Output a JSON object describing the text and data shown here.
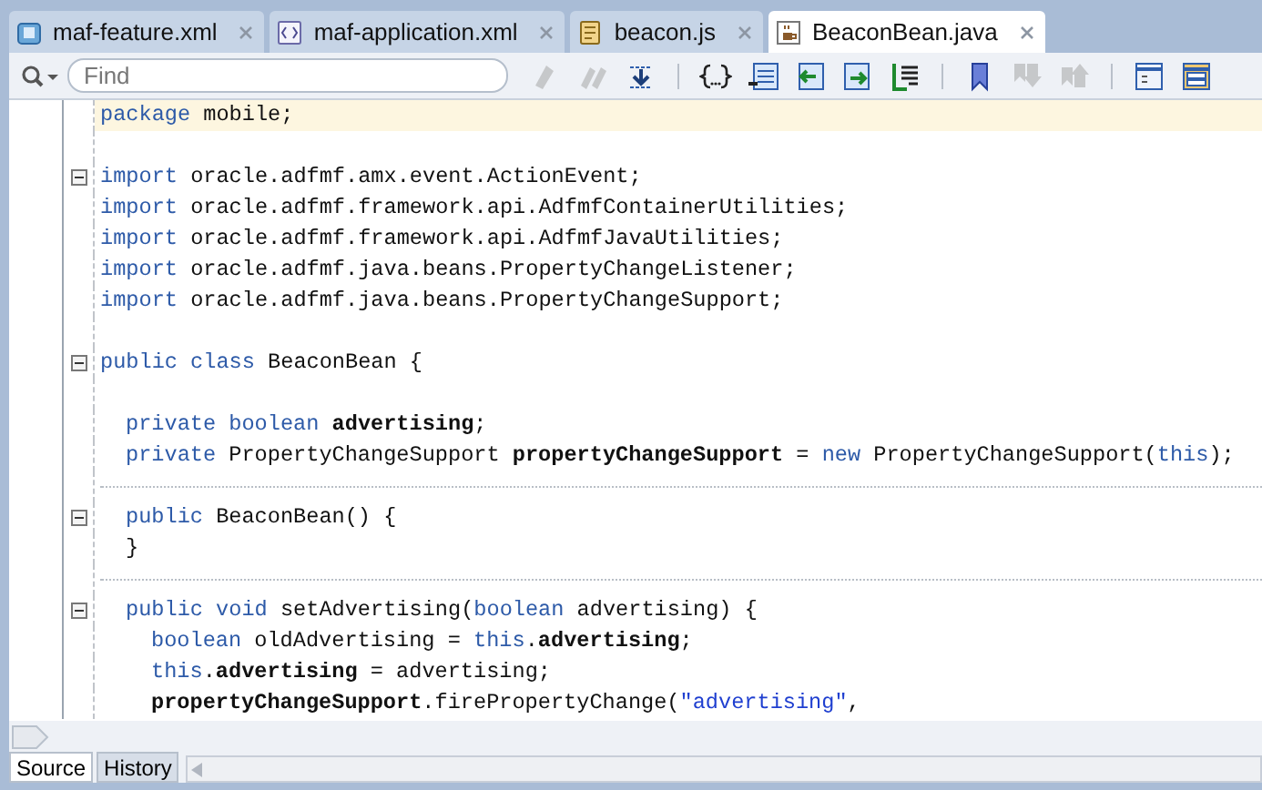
{
  "tabs": [
    {
      "label": "maf-feature.xml",
      "selected": false
    },
    {
      "label": "maf-application.xml",
      "selected": false
    },
    {
      "label": "beacon.js",
      "selected": false
    },
    {
      "label": "BeaconBean.java",
      "selected": true
    }
  ],
  "toolbar": {
    "search": {
      "placeholder": "Find"
    },
    "tools": [
      {
        "kind": "marker",
        "disabled": true
      },
      {
        "kind": "marker-double",
        "disabled": true
      },
      {
        "kind": "download",
        "disabled": false
      },
      {
        "kind": "separator",
        "disabled": false
      },
      {
        "kind": "braces",
        "disabled": false
      },
      {
        "kind": "doc-numbers",
        "disabled": false
      },
      {
        "kind": "doc-back",
        "disabled": false
      },
      {
        "kind": "doc-forward",
        "disabled": false
      },
      {
        "kind": "doc-list",
        "disabled": false
      },
      {
        "kind": "separator",
        "disabled": false
      },
      {
        "kind": "bookmark",
        "disabled": false
      },
      {
        "kind": "bookmark-down",
        "disabled": true
      },
      {
        "kind": "bookmark-up",
        "disabled": true
      },
      {
        "kind": "separator",
        "disabled": false
      },
      {
        "kind": "panel",
        "disabled": false
      },
      {
        "kind": "panel-split",
        "disabled": false
      }
    ]
  },
  "editor": {
    "lines": [
      {
        "kind": "code",
        "current": true,
        "foldable": false,
        "tokens": [
          {
            "kind": "kw",
            "text": "package"
          },
          {
            "kind": "plain",
            "text": " mobile;"
          }
        ]
      },
      {
        "kind": "blank",
        "current": false,
        "foldable": false
      },
      {
        "kind": "code",
        "current": false,
        "foldable": true,
        "tokens": [
          {
            "kind": "kw",
            "text": "import"
          },
          {
            "kind": "plain",
            "text": " oracle.adfmf.amx.event.ActionEvent;"
          }
        ]
      },
      {
        "kind": "code",
        "current": false,
        "foldable": false,
        "tokens": [
          {
            "kind": "kw",
            "text": "import"
          },
          {
            "kind": "plain",
            "text": " oracle.adfmf.framework.api.AdfmfContainerUtilities;"
          }
        ]
      },
      {
        "kind": "code",
        "current": false,
        "foldable": false,
        "tokens": [
          {
            "kind": "kw",
            "text": "import"
          },
          {
            "kind": "plain",
            "text": " oracle.adfmf.framework.api.AdfmfJavaUtilities;"
          }
        ]
      },
      {
        "kind": "code",
        "current": false,
        "foldable": false,
        "tokens": [
          {
            "kind": "kw",
            "text": "import"
          },
          {
            "kind": "plain",
            "text": " oracle.adfmf.java.beans.PropertyChangeListener;"
          }
        ]
      },
      {
        "kind": "code",
        "current": false,
        "foldable": false,
        "tokens": [
          {
            "kind": "kw",
            "text": "import"
          },
          {
            "kind": "plain",
            "text": " oracle.adfmf.java.beans.PropertyChangeSupport;"
          }
        ]
      },
      {
        "kind": "blank",
        "current": false,
        "foldable": false
      },
      {
        "kind": "code",
        "current": false,
        "foldable": true,
        "tokens": [
          {
            "kind": "kw",
            "text": "public class"
          },
          {
            "kind": "plain",
            "text": " BeaconBean {"
          }
        ]
      },
      {
        "kind": "blank",
        "current": false,
        "foldable": false
      },
      {
        "kind": "member",
        "current": false,
        "foldable": false,
        "tokens": [
          {
            "kind": "kw",
            "text": "private boolean"
          },
          {
            "kind": "field",
            "text": " advertising"
          },
          {
            "kind": "plain",
            "text": ";"
          }
        ]
      },
      {
        "kind": "member",
        "current": false,
        "foldable": false,
        "tokens": [
          {
            "kind": "kw",
            "text": "private"
          },
          {
            "kind": "plain",
            "text": " PropertyChangeSupport "
          },
          {
            "kind": "field",
            "text": "propertyChangeSupport"
          },
          {
            "kind": "plain",
            "text": " = "
          },
          {
            "kind": "kw",
            "text": "new"
          },
          {
            "kind": "plain",
            "text": " PropertyChangeSupport("
          },
          {
            "kind": "kw",
            "text": "this"
          },
          {
            "kind": "plain",
            "text": ");"
          }
        ]
      },
      {
        "kind": "separator",
        "current": false,
        "foldable": false
      },
      {
        "kind": "member",
        "current": false,
        "foldable": true,
        "tokens": [
          {
            "kind": "kw",
            "text": "public"
          },
          {
            "kind": "plain",
            "text": " BeaconBean() {"
          }
        ]
      },
      {
        "kind": "member",
        "current": false,
        "foldable": false,
        "tokens": [
          {
            "kind": "plain",
            "text": "}"
          }
        ]
      },
      {
        "kind": "separator",
        "current": false,
        "foldable": false
      },
      {
        "kind": "member",
        "current": false,
        "foldable": true,
        "tokens": [
          {
            "kind": "kw",
            "text": "public void"
          },
          {
            "kind": "plain",
            "text": " setAdvertising("
          },
          {
            "kind": "kw",
            "text": "boolean"
          },
          {
            "kind": "plain",
            "text": " advertising) {"
          }
        ]
      },
      {
        "kind": "statement",
        "current": false,
        "foldable": false,
        "tokens": [
          {
            "kind": "kw",
            "text": "boolean"
          },
          {
            "kind": "plain",
            "text": " oldAdvertising = "
          },
          {
            "kind": "kw",
            "text": "this"
          },
          {
            "kind": "plain",
            "text": "."
          },
          {
            "kind": "field",
            "text": "advertising"
          },
          {
            "kind": "plain",
            "text": ";"
          }
        ]
      },
      {
        "kind": "statement",
        "current": false,
        "foldable": false,
        "tokens": [
          {
            "kind": "kw",
            "text": "this"
          },
          {
            "kind": "plain",
            "text": "."
          },
          {
            "kind": "field",
            "text": "advertising"
          },
          {
            "kind": "plain",
            "text": " = advertising;"
          }
        ]
      },
      {
        "kind": "statement",
        "current": false,
        "foldable": false,
        "tokens": [
          {
            "kind": "field",
            "text": "propertyChangeSupport"
          },
          {
            "kind": "plain",
            "text": ".firePropertyChange("
          },
          {
            "kind": "string",
            "text": "\"advertising\""
          },
          {
            "kind": "plain",
            "text": ","
          }
        ]
      }
    ]
  },
  "bottom_tabs": [
    {
      "label": "Source",
      "selected": true
    },
    {
      "label": "History",
      "selected": false
    }
  ]
}
